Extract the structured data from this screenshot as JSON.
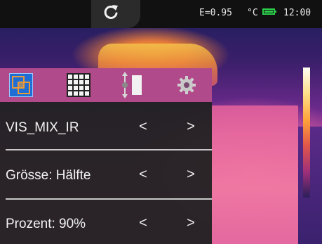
{
  "status_bar": {
    "refresh_icon": "refresh-icon",
    "emissivity": "E=0.95",
    "unit": "°C",
    "battery_icon": "battery-icon",
    "battery_color": "#2ad04a",
    "time": "12:00"
  },
  "toolbar": {
    "icons": [
      "vis-mix-icon",
      "grid-icon",
      "scale-adjust-icon",
      "settings-icon"
    ],
    "accent": "#b04a8a",
    "selected_color": "#1f6ed6"
  },
  "menu": {
    "rows": [
      {
        "label": "VIS_MIX_IR",
        "left": "<",
        "right": ">"
      },
      {
        "label": "Grösse: Hälfte",
        "left": "<",
        "right": ">"
      },
      {
        "label": "Prozent:  90%",
        "left": "<",
        "right": ">"
      }
    ]
  }
}
